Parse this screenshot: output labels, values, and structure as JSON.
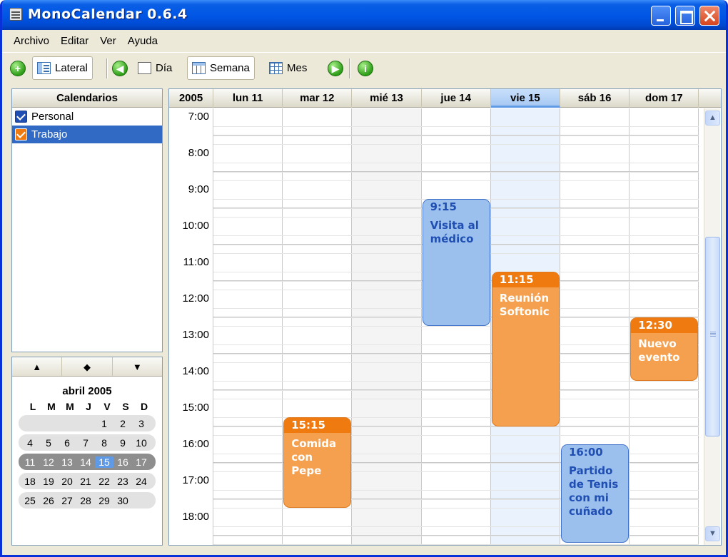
{
  "window": {
    "title": "MonoCalendar 0.6.4"
  },
  "menu": [
    "Archivo",
    "Editar",
    "Ver",
    "Ayuda"
  ],
  "toolbar": {
    "lateral": "Lateral",
    "dia": "Día",
    "semana": "Semana",
    "mes": "Mes",
    "add_icon": "+",
    "info_icon": "i"
  },
  "calendars": {
    "header": "Calendarios",
    "items": [
      {
        "label": "Personal",
        "color": "#1f4fb3"
      },
      {
        "label": "Trabajo",
        "color": "#ee7a10"
      }
    ]
  },
  "mini_calendar": {
    "nav": [
      "▲",
      "◆",
      "▼"
    ],
    "title": "abril 2005",
    "weekdays": [
      "L",
      "M",
      "M",
      "J",
      "V",
      "S",
      "D"
    ],
    "weeks": [
      [
        "",
        "",
        "",
        "",
        "1",
        "2",
        "3"
      ],
      [
        "4",
        "5",
        "6",
        "7",
        "8",
        "9",
        "10"
      ],
      [
        "11",
        "12",
        "13",
        "14",
        "15",
        "16",
        "17"
      ],
      [
        "18",
        "19",
        "20",
        "21",
        "22",
        "23",
        "24"
      ],
      [
        "25",
        "26",
        "27",
        "28",
        "29",
        "30",
        ""
      ]
    ],
    "selected_week": 2,
    "today": "15"
  },
  "week": {
    "year": "2005",
    "days": [
      "lun 11",
      "mar 12",
      "mié 13",
      "jue 14",
      "vie 15",
      "sáb 16",
      "dom 17"
    ],
    "today_index": 4,
    "hours": [
      "7:00",
      "8:00",
      "9:00",
      "10:00",
      "11:00",
      "12:00",
      "13:00",
      "14:00",
      "15:00",
      "16:00",
      "17:00",
      "18:00"
    ],
    "events": [
      {
        "day": 3,
        "start": 9.25,
        "end": 12.75,
        "time": "9:15",
        "title": "Visita al médico",
        "calendar": "Personal",
        "style": "blue"
      },
      {
        "day": 4,
        "start": 11.25,
        "end": 15.5,
        "time": "11:15",
        "title": "Reunión Softonic",
        "calendar": "Trabajo",
        "style": "orange"
      },
      {
        "day": 6,
        "start": 12.5,
        "end": 14.25,
        "time": "12:30",
        "title": "Nuevo evento",
        "calendar": "Trabajo",
        "style": "orange"
      },
      {
        "day": 1,
        "start": 15.25,
        "end": 17.75,
        "time": "15:15",
        "title": "Comida con Pepe",
        "calendar": "Trabajo",
        "style": "orange"
      },
      {
        "day": 5,
        "start": 16.0,
        "end": 18.75,
        "time": "16:00",
        "title": "Partido de Tenis con mi cuñado",
        "calendar": "Personal",
        "style": "blue"
      }
    ]
  }
}
